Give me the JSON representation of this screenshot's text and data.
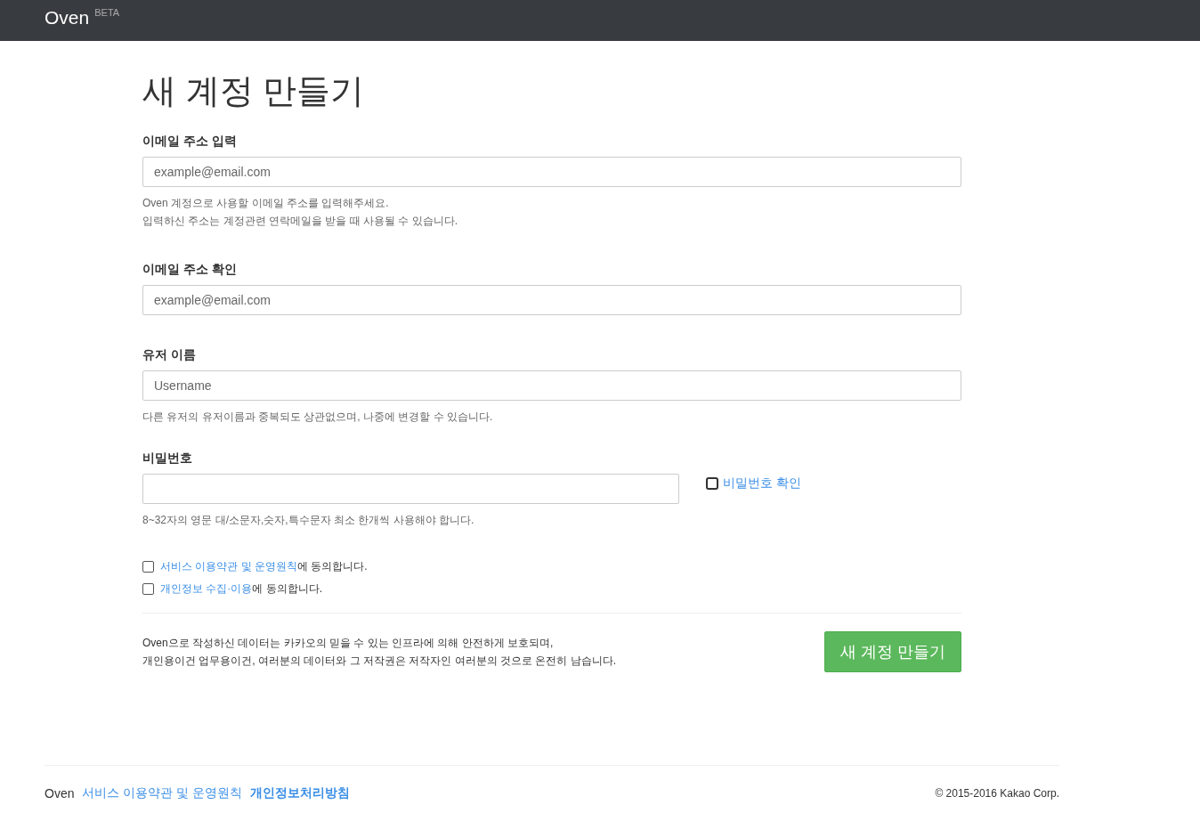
{
  "navbar": {
    "brand": "Oven",
    "badge": "BETA"
  },
  "title": "새 계정 만들기",
  "fields": [
    {
      "kind": "text",
      "label": "이메일 주소 입력",
      "placeholder": "example@email.com",
      "help": [
        "Oven 계정으로 사용할 이메일 주소를 입력해주세요.",
        "입력하신 주소는 계정관련 연락메일을 받을 때 사용될 수 있습니다."
      ]
    },
    {
      "kind": "text",
      "label": "이메일 주소 확인",
      "placeholder": "example@email.com"
    },
    {
      "kind": "text",
      "label": "유저 이름",
      "placeholder": "Username",
      "help": [
        "다른 유저의 유저이름과 중복되도 상관없으며, 나중에 변경할 수 있습니다."
      ]
    },
    {
      "kind": "password",
      "label": "비밀번호",
      "help": [
        "8~32자의 영문 대/소문자,숫자,특수문자 최소 한개씩 사용해야 합니다."
      ],
      "toggle": {
        "label": "비밀번호 확인",
        "checked": false
      }
    }
  ],
  "agreements": [
    {
      "link": "서비스 이용약관 및 운영원칙",
      "text": "에 동의합니다.",
      "checked": false
    },
    {
      "link": "개인정보 수집·이용",
      "text": "에 동의합니다.",
      "checked": false
    }
  ],
  "notice": [
    "Oven으로 작성하신 데이터는 카카오의 믿을 수 있는 인프라에 의해 안전하게 보호되며,",
    "개인용이건 업무용이건, 여러분의 데이터와 그 저작권은 저작자인 여러분의 것으로 온전히 남습니다."
  ],
  "submit": "새 계정 만들기",
  "footer": {
    "brand": "Oven",
    "links": [
      {
        "label": "서비스 이용약관 및 운영원칙",
        "bold": false
      },
      {
        "label": "개인정보처리방침",
        "bold": true
      }
    ],
    "copyright": "© 2015-2016 Kakao Corp."
  }
}
